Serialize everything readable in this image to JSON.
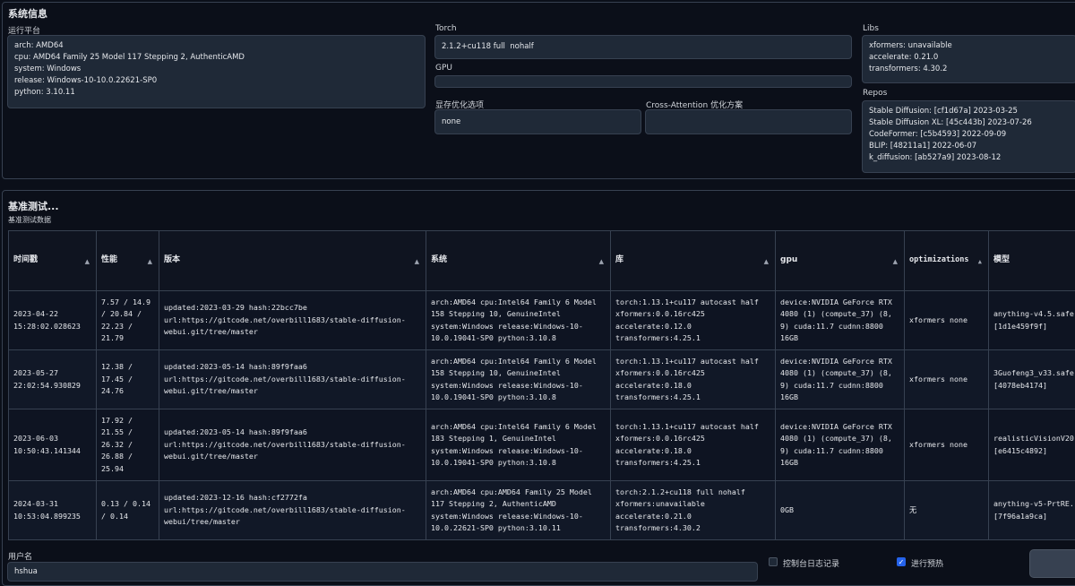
{
  "system_info": {
    "title": "系统信息",
    "platform": {
      "label": "运行平台",
      "lines": "arch: AMD64\ncpu: AMD64 Family 25 Model 117 Stepping 2, AuthenticAMD\nsystem: Windows\nrelease: Windows-10-10.0.22621-SP0\npython: 3.10.11"
    },
    "torch": {
      "label": "Torch",
      "value": "2.1.2+cu118 full  nohalf"
    },
    "gpu": {
      "label": "GPU",
      "value": ""
    },
    "mem_opt": {
      "label": "显存优化选项",
      "value": "none"
    },
    "cross_attention": {
      "label": "Cross-Attention 优化方案",
      "value": ""
    },
    "libs": {
      "label": "Libs",
      "lines": "xformers: unavailable\naccelerate: 0.21.0\ntransformers: 4.30.2"
    },
    "repos": {
      "label": "Repos",
      "lines": "Stable Diffusion: [cf1d67a] 2023-03-25\nStable Diffusion XL: [45c443b] 2023-07-26\nCodeFormer: [c5b4593] 2022-09-09\nBLIP: [48211a1] 2022-06-07\nk_diffusion: [ab527a9] 2023-08-12"
    }
  },
  "benchmark": {
    "title": "基准测试...",
    "subtitle": "基准测试数据",
    "columns": [
      "时间戳",
      "性能",
      "版本",
      "系统",
      "库",
      "gpu",
      "optimizations",
      "模型"
    ],
    "rows": [
      [
        "2023-04-22\n15:28:02.028623",
        "7.57 / 14.9\n/ 20.84 /\n22.23 /\n21.79",
        "updated:2023-03-29 hash:22bcc7be\nurl:https://gitcode.net/overbill1683/stable-diffusion-\nwebui.git/tree/master",
        "arch:AMD64 cpu:Intel64 Family 6 Model\n158 Stepping 10, GenuineIntel\nsystem:Windows release:Windows-10-\n10.0.19041-SP0 python:3.10.8",
        "torch:1.13.1+cu117 autocast half\nxformers:0.0.16rc425\naccelerate:0.12.0\ntransformers:4.25.1",
        "device:NVIDIA GeForce RTX\n4080 (1) (compute_37) (8,\n9) cuda:11.7 cudnn:8800\n16GB",
        "xformers none",
        "anything-v4.5.safe\n[1d1e459f9f]"
      ],
      [
        "2023-05-27\n22:02:54.930829",
        "12.38 /\n17.45 /\n24.76",
        "updated:2023-05-14 hash:89f9faa6\nurl:https://gitcode.net/overbill1683/stable-diffusion-\nwebui.git/tree/master",
        "arch:AMD64 cpu:Intel64 Family 6 Model\n158 Stepping 10, GenuineIntel\nsystem:Windows release:Windows-10-\n10.0.19041-SP0 python:3.10.8",
        "torch:1.13.1+cu117 autocast half\nxformers:0.0.16rc425\naccelerate:0.18.0\ntransformers:4.25.1",
        "device:NVIDIA GeForce RTX\n4080 (1) (compute_37) (8,\n9) cuda:11.7 cudnn:8800\n16GB",
        "xformers none",
        "3Guofeng3_v33.safe\n[4078eb4174]"
      ],
      [
        "2023-06-03\n10:50:43.141344",
        "17.92 /\n21.55 /\n26.32 /\n26.88 /\n25.94",
        "updated:2023-05-14 hash:89f9faa6\nurl:https://gitcode.net/overbill1683/stable-diffusion-\nwebui.git/tree/master",
        "arch:AMD64 cpu:Intel64 Family 6 Model\n183 Stepping 1, GenuineIntel\nsystem:Windows release:Windows-10-\n10.0.19041-SP0 python:3.10.8",
        "torch:1.13.1+cu117 autocast half\nxformers:0.0.16rc425\naccelerate:0.18.0\ntransformers:4.25.1",
        "device:NVIDIA GeForce RTX\n4080 (1) (compute_37) (8,\n9) cuda:11.7 cudnn:8800\n16GB",
        "xformers none",
        "realisticVisionV20\n[e6415c4892]"
      ],
      [
        "2024-03-31\n10:53:04.899235",
        "0.13 / 0.14\n/ 0.14",
        "updated:2023-12-16 hash:cf2772fa\nurl:https://gitcode.net/overbill1683/stable-diffusion-\nwebui/tree/master",
        "arch:AMD64 cpu:AMD64 Family 25 Model\n117 Stepping 2, AuthenticAMD\nsystem:Windows release:Windows-10-\n10.0.22621-SP0 python:3.10.11",
        "torch:2.1.2+cu118 full nohalf\nxformers:unavailable\naccelerate:0.21.0\ntransformers:4.30.2",
        "0GB",
        "无",
        "anything-v5-PrtRE.\n[7f96a1a9ca]"
      ]
    ]
  },
  "footer": {
    "username_label": "用户名",
    "username_value": "hshua",
    "console_log_label": "控制台日志记录",
    "console_log_checked": false,
    "warmup_label": "进行预热",
    "warmup_checked": true
  },
  "colors": {
    "background": "#0b0f19",
    "field": "#1f2937",
    "border": "#374151",
    "checkbox_on": "#2563eb"
  },
  "icons": {
    "sort": "sort-arrow-icon",
    "check": "checkmark-icon"
  }
}
